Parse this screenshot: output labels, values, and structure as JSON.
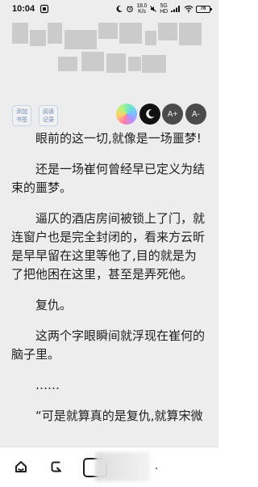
{
  "status_bar": {
    "time": "10:04",
    "speed_top": "18.0",
    "speed_bottom": "K/s",
    "network_top": "5G",
    "network_bottom": "HD",
    "battery": "76",
    "icons": [
      "app-square-icon",
      "dnd-moon-icon",
      "alarm-icon",
      "mute-icon",
      "signal-icon",
      "wifi-icon",
      "battery-icon"
    ]
  },
  "toolbar": {
    "add_bookmark_top": "添加",
    "add_bookmark_bottom": "书签",
    "read_record_top": "阅读",
    "read_record_bottom": "记录",
    "font_increase": "A+",
    "font_decrease": "A-",
    "icons": [
      "color-theme-icon",
      "night-mode-icon"
    ]
  },
  "content": {
    "paragraphs": [
      "眼前的这一切,就像是一场噩梦!",
      "还是一场崔何曾经早已定义为结束的噩梦。",
      "逼仄的酒店房间被锁上了门，就连窗户也是完全封闭的，看来方云昕是早早留在这里等他了,目的就是为了把他困在这里，甚至是弄死他。",
      "复仇。",
      "这两个字眼瞬间就浮现在崔何的脑子里。",
      "……",
      "“可是就算真的是复仇,就算宋微"
    ]
  },
  "bottom_bar": {
    "icons": [
      "home-icon",
      "back-icon",
      "tabs-icon"
    ]
  },
  "colors": {
    "background": "#ededed",
    "text": "#202020",
    "accent": "#6f87b8",
    "blur": "#cbcbcb"
  }
}
